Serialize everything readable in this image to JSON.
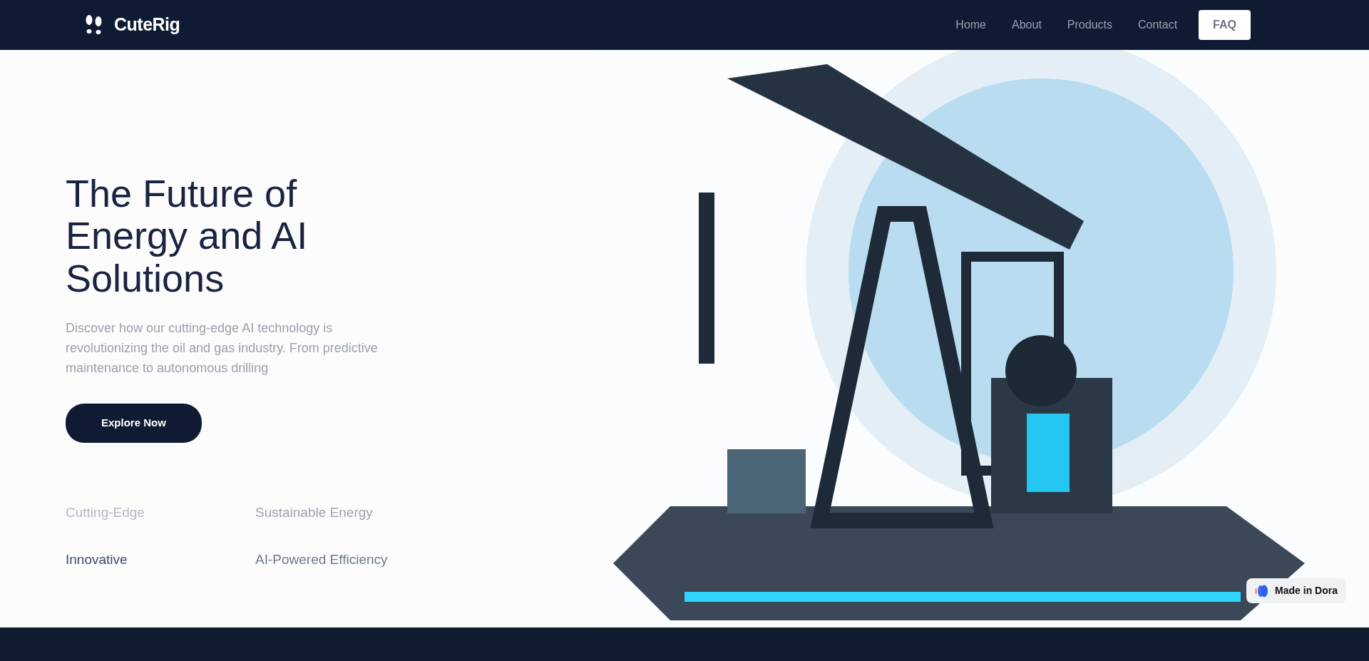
{
  "brand": {
    "name": "CuteRig"
  },
  "nav": [
    {
      "label": "Home",
      "kind": "link"
    },
    {
      "label": "About",
      "kind": "link"
    },
    {
      "label": "Products",
      "kind": "link"
    },
    {
      "label": "Contact",
      "kind": "link"
    },
    {
      "label": "FAQ",
      "kind": "button"
    }
  ],
  "hero": {
    "title": "The Future of Energy and AI Solutions",
    "text": "Discover how our cutting-edge AI technology is revolutionizing the oil and gas industry. From predictive maintenance to autonomous drilling",
    "cta": "Explore Now"
  },
  "features": [
    {
      "label": "Cutting-Edge",
      "color": "#b4b8c4"
    },
    {
      "label": "Sustainable Energy",
      "color": "#9ea3ae"
    },
    {
      "label": "Innovative",
      "color": "#3e4a6b"
    },
    {
      "label": "AI-Powered Efficiency",
      "color": "#6f7888"
    }
  ],
  "badge": {
    "label": "Made in Dora"
  }
}
